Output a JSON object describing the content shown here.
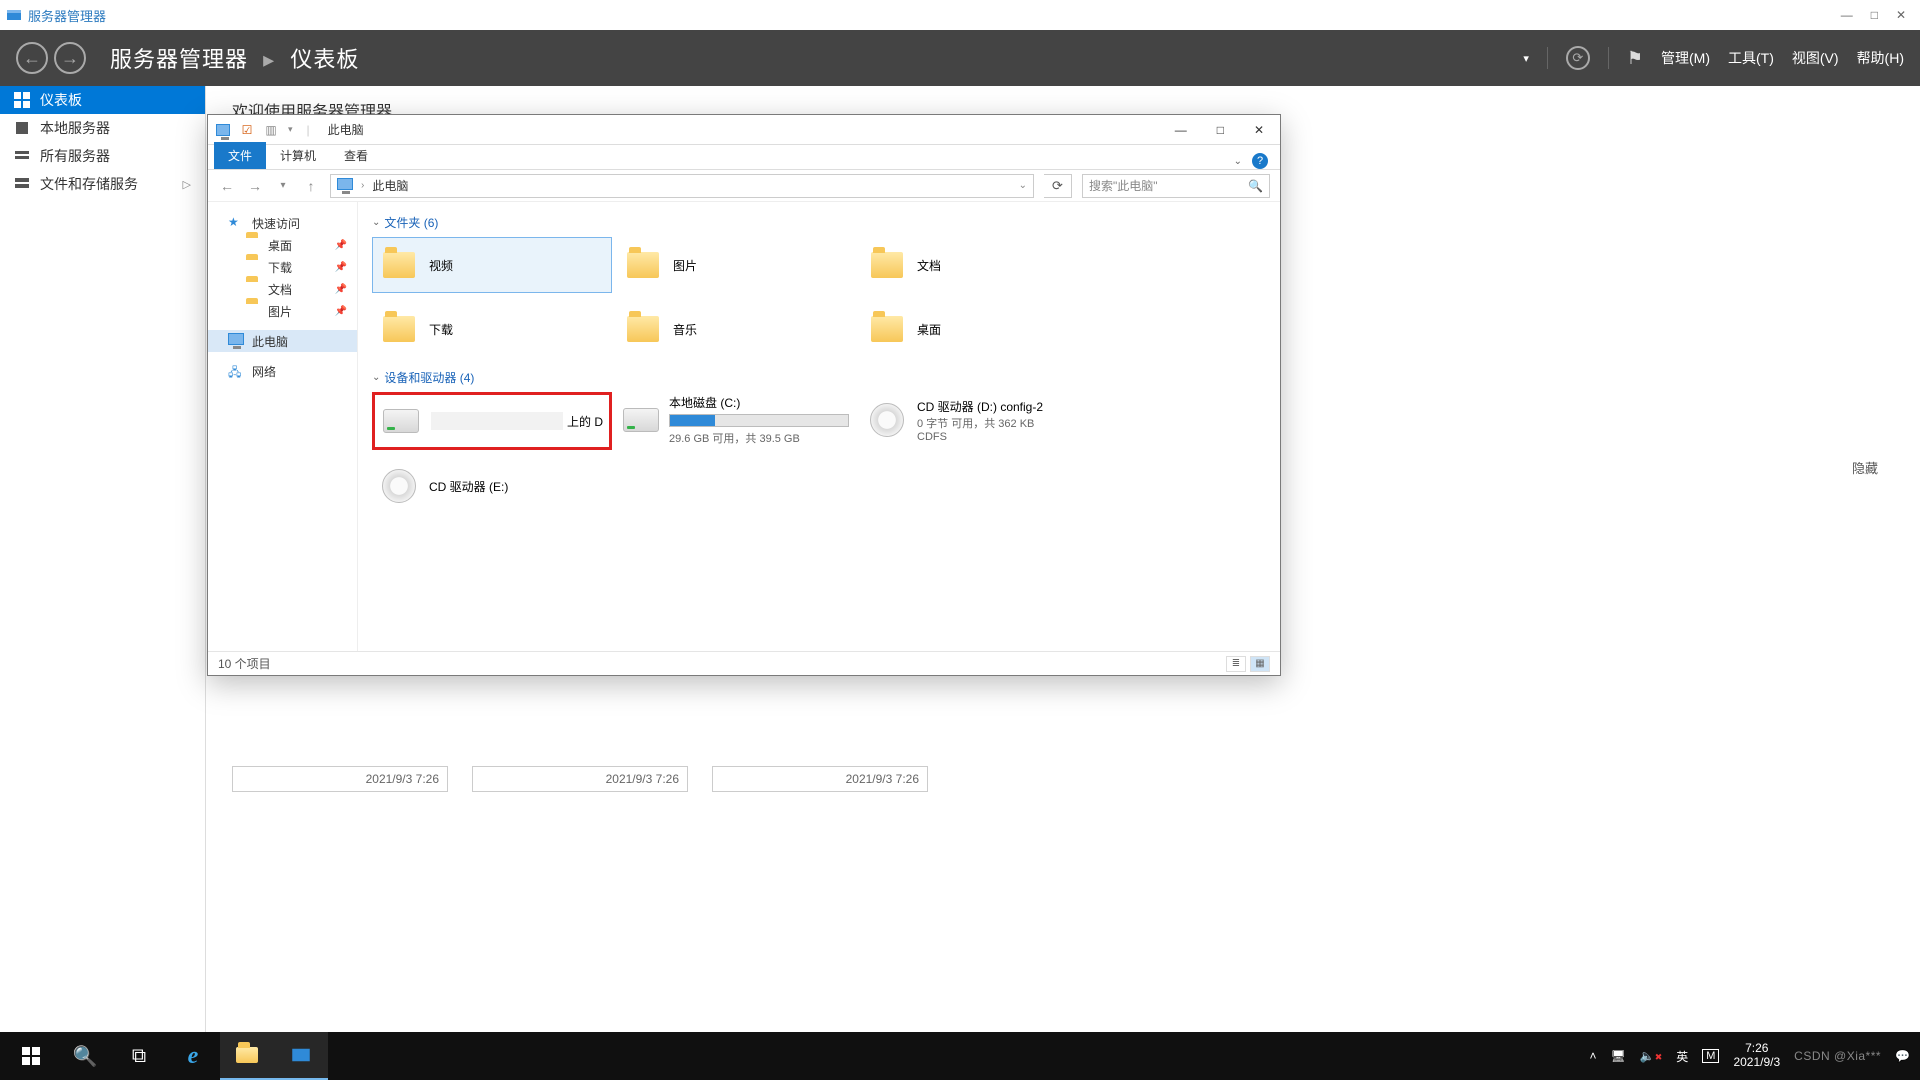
{
  "serverManager": {
    "title": "服务器管理器",
    "window_buttons": {
      "min": "—",
      "max": "□",
      "close": "✕"
    },
    "banner": {
      "breadcrumb_root": "服务器管理器",
      "breadcrumb_sep": "·",
      "breadcrumb_leaf": "仪表板",
      "menus": {
        "manage": "管理(M)",
        "tools": "工具(T)",
        "view": "视图(V)",
        "help": "帮助(H)"
      }
    },
    "sidebar": [
      {
        "label": "仪表板",
        "active": true
      },
      {
        "label": "本地服务器",
        "active": false
      },
      {
        "label": "所有服务器",
        "active": false
      },
      {
        "label": "文件和存储服务",
        "active": false,
        "expandable": true
      }
    ],
    "welcome_heading": "欢迎使用服务器管理器",
    "hide_label": "隐藏",
    "tiles_timestamp": "2021/9/3 7:26"
  },
  "explorer": {
    "titlebar_caption": "此电脑",
    "window_buttons": {
      "min": "—",
      "max": "□",
      "close": "✕"
    },
    "ribbon_tabs": {
      "file": "文件",
      "computer": "计算机",
      "view": "查看"
    },
    "address_label": "此电脑",
    "search_placeholder": "搜索\"此电脑\"",
    "nav": {
      "quick": "快速访问",
      "quick_items": [
        {
          "label": "桌面"
        },
        {
          "label": "下载"
        },
        {
          "label": "文档"
        },
        {
          "label": "图片"
        }
      ],
      "thispc": "此电脑",
      "network": "网络"
    },
    "groups": {
      "folders": {
        "header": "文件夹 (6)",
        "items": [
          {
            "label": "视频",
            "selected": true,
            "icon": "video"
          },
          {
            "label": "图片",
            "icon": "pictures"
          },
          {
            "label": "文档",
            "icon": "documents"
          },
          {
            "label": "下载",
            "icon": "downloads"
          },
          {
            "label": "音乐",
            "icon": "music"
          },
          {
            "label": "桌面",
            "icon": "desktop"
          }
        ]
      },
      "devices": {
        "header": "设备和驱动器 (4)",
        "items": [
          {
            "label": "上的 D",
            "sub": "",
            "icon": "drive",
            "highlighted": true
          },
          {
            "label": "本地磁盘 (C:)",
            "sub": "29.6 GB 可用，共 39.5 GB",
            "fill": 25,
            "icon": "drive"
          },
          {
            "label": "CD 驱动器 (D:) config-2",
            "sub": "0 字节 可用，共 362 KB",
            "sub2": "CDFS",
            "icon": "cd"
          },
          {
            "label": "CD 驱动器 (E:)",
            "sub": "",
            "icon": "cd"
          }
        ]
      }
    },
    "status": "10 个项目"
  },
  "taskbar": {
    "ime": "英",
    "ime2": "M",
    "time": "7:26",
    "date": "2021/9/3",
    "watermark": "CSDN @Xia***"
  }
}
